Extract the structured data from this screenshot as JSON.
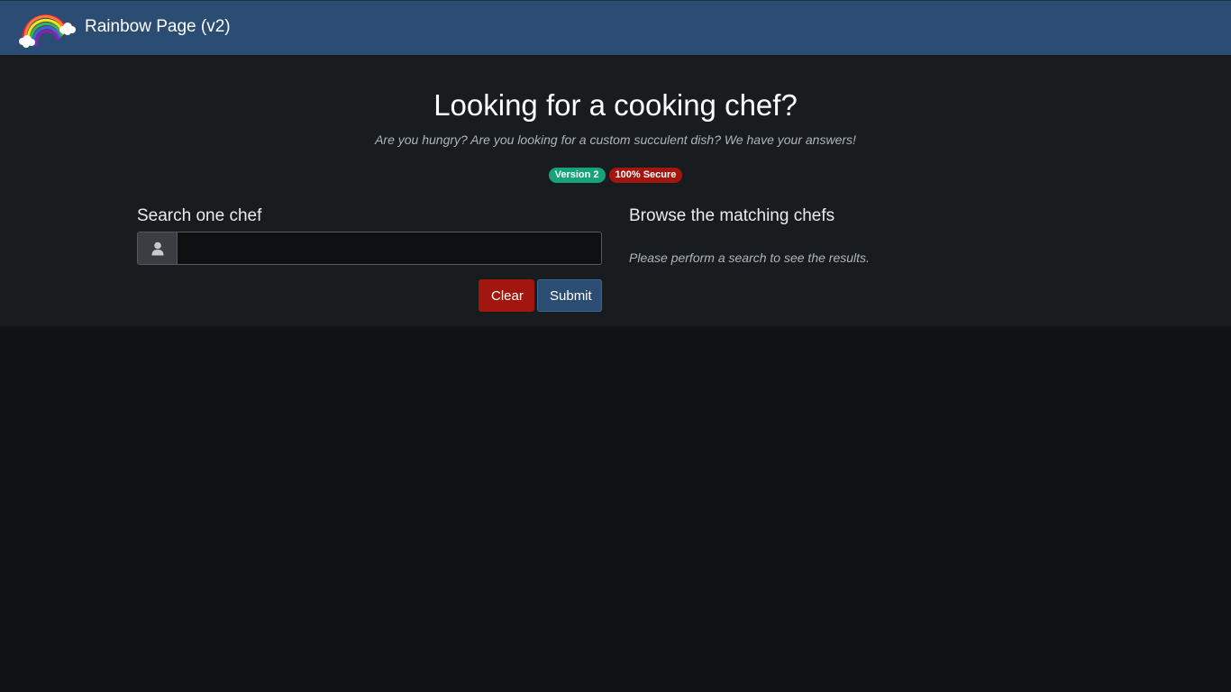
{
  "navbar": {
    "brand_title": "Rainbow Page (v2)",
    "logo_icon": "rainbow-logo"
  },
  "hero": {
    "title": "Looking for a cooking chef?",
    "subtitle": "Are you hungry? Are you looking for a custom succulent dish? We have your answers!",
    "badges": [
      {
        "label": "Version 2",
        "color": "#16a37b"
      },
      {
        "label": "100% Secure",
        "color": "#a3160f"
      }
    ]
  },
  "search": {
    "label": "Search one chef",
    "addon_icon": "user-icon",
    "value": "",
    "placeholder": "",
    "clear_label": "Clear",
    "submit_label": "Submit"
  },
  "results": {
    "label": "Browse the matching chefs",
    "empty_text": "Please perform a search to see the results."
  },
  "colors": {
    "navbar": "#2c4d73",
    "hero_bg": "#191c1f",
    "page_bg": "#111214",
    "clear_button": "#a1170f",
    "submit_button": "#2c4d73"
  }
}
